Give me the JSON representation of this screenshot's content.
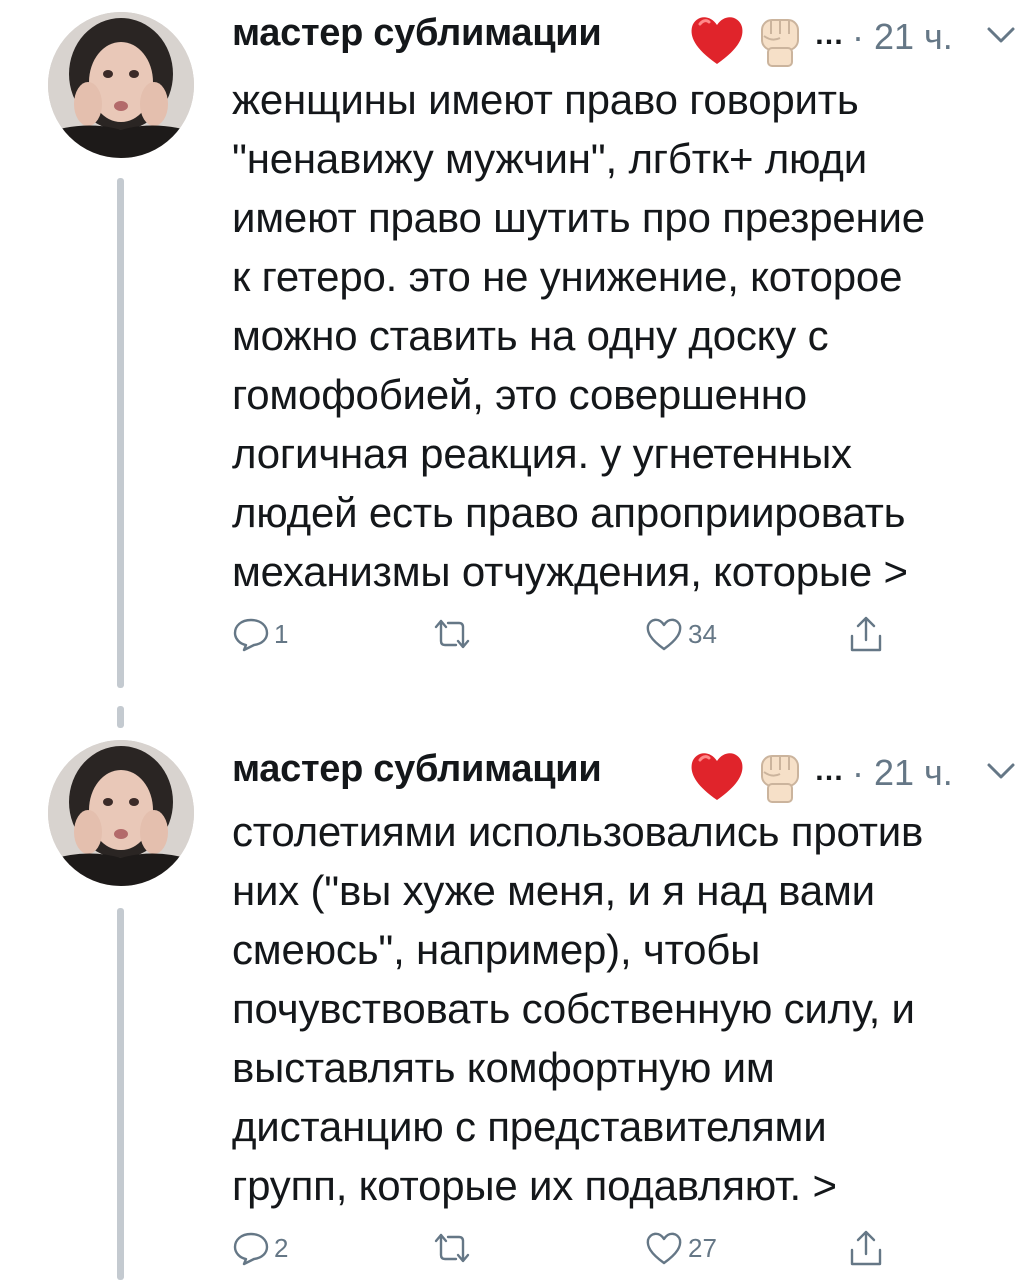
{
  "tweets": [
    {
      "author_name": "мастер сублимации",
      "emoji_icons": [
        "heart-icon",
        "raised-fist-icon"
      ],
      "ellipsis": "…",
      "time": "· 21 ч.",
      "text_lines": [
        "женщины имеют право говорить",
        "\"ненавижу мужчин\", лгбтк+ люди",
        "имеют право шутить про презрение",
        "к гетеро. это не унижение, которое",
        "можно ставить на одну доску с",
        "гомофобией, это совершенно",
        "логичная реакция. у угнетенных",
        "людей есть право апроприировать",
        "механизмы отчуждения, которые >"
      ],
      "reply_count": "1",
      "retweet_count": "",
      "like_count": "34"
    },
    {
      "author_name": "мастер сублимации",
      "emoji_icons": [
        "heart-icon",
        "raised-fist-icon"
      ],
      "ellipsis": "…",
      "time": "· 21 ч.",
      "text_lines": [
        "столетиями использовались против",
        "них (\"вы хуже меня, и я над вами",
        "смеюсь\", например), чтобы",
        "почувствовать собственную силу, и",
        "выставлять комфортную им",
        "дистанцию с представителями",
        "групп, которые их подавляют. >"
      ],
      "reply_count": "2",
      "retweet_count": "",
      "like_count": "27"
    }
  ],
  "colors": {
    "text": "#14171a",
    "secondary": "#657786",
    "thread_line": "#c4cad0",
    "heart": "#e0242b"
  }
}
